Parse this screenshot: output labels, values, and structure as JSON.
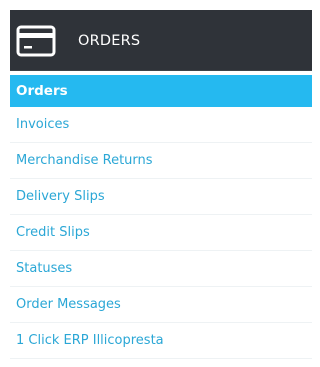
{
  "menu": {
    "header_label": "ORDERS",
    "header_icon": "credit-card-icon",
    "colors": {
      "header_bg": "#2f3339",
      "active_bg": "#25b9f0",
      "link": "#2ba7d6"
    },
    "items": [
      {
        "label": "Orders",
        "active": true
      },
      {
        "label": "Invoices",
        "active": false
      },
      {
        "label": "Merchandise Returns",
        "active": false
      },
      {
        "label": "Delivery Slips",
        "active": false
      },
      {
        "label": "Credit Slips",
        "active": false
      },
      {
        "label": "Statuses",
        "active": false
      },
      {
        "label": "Order Messages",
        "active": false
      },
      {
        "label": "1 Click ERP Illicopresta",
        "active": false
      }
    ]
  }
}
